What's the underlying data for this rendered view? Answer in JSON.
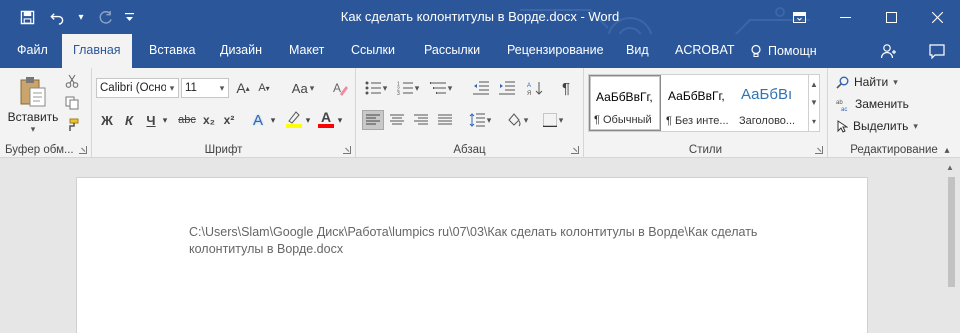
{
  "window": {
    "title": "Как сделать колонтитулы в Ворде.docx - Word"
  },
  "quick_access": {
    "save_icon": "save-icon",
    "undo_icon": "undo-icon",
    "redo_icon": "redo-icon",
    "customize_icon": "customize-qat-icon"
  },
  "tabs": [
    {
      "label": "Файл"
    },
    {
      "label": "Главная"
    },
    {
      "label": "Вставка"
    },
    {
      "label": "Дизайн"
    },
    {
      "label": "Макет"
    },
    {
      "label": "Ссылки"
    },
    {
      "label": "Рассылки"
    },
    {
      "label": "Рецензирование"
    },
    {
      "label": "Вид"
    },
    {
      "label": "ACROBAT"
    }
  ],
  "active_tab": "Главная",
  "help_label": "Помощн",
  "clipboard": {
    "paste_label": "Вставить",
    "group_label": "Буфер обм..."
  },
  "font": {
    "font_name": "Calibri (Осно",
    "font_size": "11",
    "grow": "A",
    "shrink": "A",
    "case": "Aa",
    "bold": "Ж",
    "italic": "К",
    "underline": "Ч",
    "strike": "abc",
    "subscript": "x₂",
    "superscript": "x²",
    "effects": "A",
    "font_color": "A",
    "group_label": "Шрифт",
    "highlight_color": "#ffff00",
    "font_color_value": "#ff0000"
  },
  "paragraph": {
    "pilcrow": "¶",
    "group_label": "Абзац"
  },
  "styles": {
    "items": [
      {
        "preview": "АаБбВвГг,",
        "name": "¶ Обычный"
      },
      {
        "preview": "АаБбВвГг,",
        "name": "¶ Без инте..."
      },
      {
        "preview": "АаБбВı",
        "name": "Заголово..."
      }
    ],
    "group_label": "Стили"
  },
  "editing": {
    "find": "Найти",
    "replace": "Заменить",
    "select": "Выделить",
    "group_label": "Редактирование"
  },
  "document": {
    "header_text": "C:\\Users\\Slam\\Google Диск\\Работа\\lumpics ru\\07\\03\\Как сделать колонтитулы в Ворде\\Как сделать колонтитулы в Ворде.docx"
  },
  "colors": {
    "brand": "#2b579a",
    "ribbon_bg": "#f3f3f3",
    "doc_bg": "#e6e6e6"
  }
}
